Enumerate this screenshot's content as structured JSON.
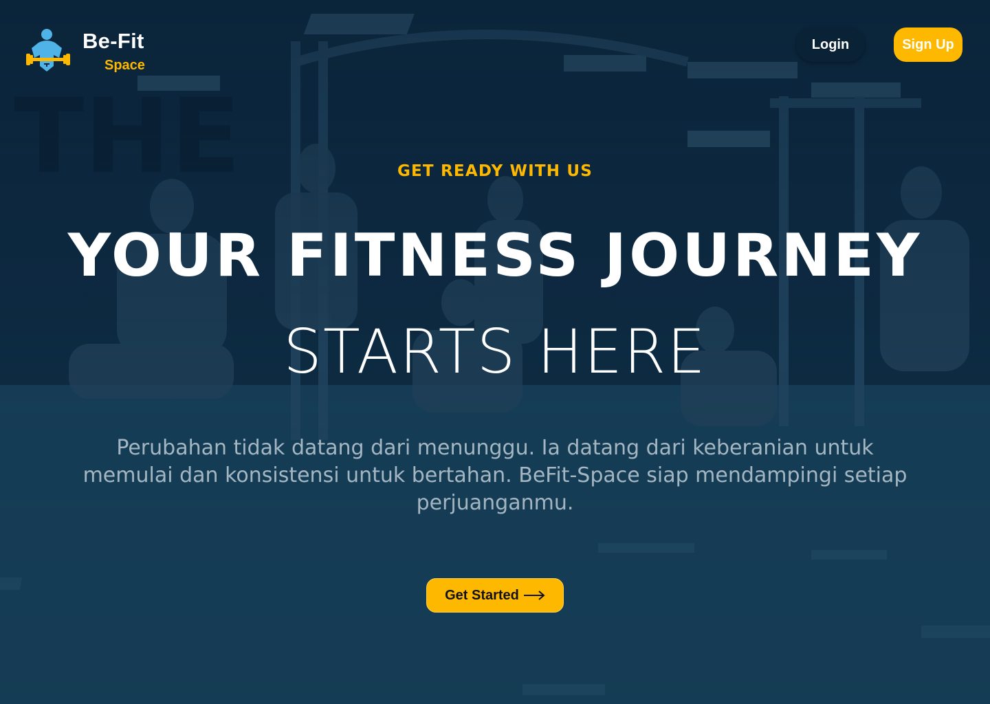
{
  "brand": {
    "title": "Be-Fit",
    "subtitle": "Space",
    "icon": "fitness-man-dumbbell-icon"
  },
  "nav": {
    "login_label": "Login",
    "signup_label": "Sign Up"
  },
  "hero": {
    "eyebrow": "GET READY WITH US",
    "headline": "YOUR FITNESS JOURNEY",
    "subheadline": "STARTS HERE",
    "description": "Perubahan tidak datang dari menunggu. Ia datang dari keberanian untuk memulai dan konsistensi untuk bertahan. BeFit-Space siap mendampingi setiap perjuanganmu.",
    "cta_label": "Get Started",
    "cta_icon": "arrow-right-icon"
  },
  "colors": {
    "accent": "#ffb800",
    "background": "#143650",
    "text": "#ffffff"
  }
}
